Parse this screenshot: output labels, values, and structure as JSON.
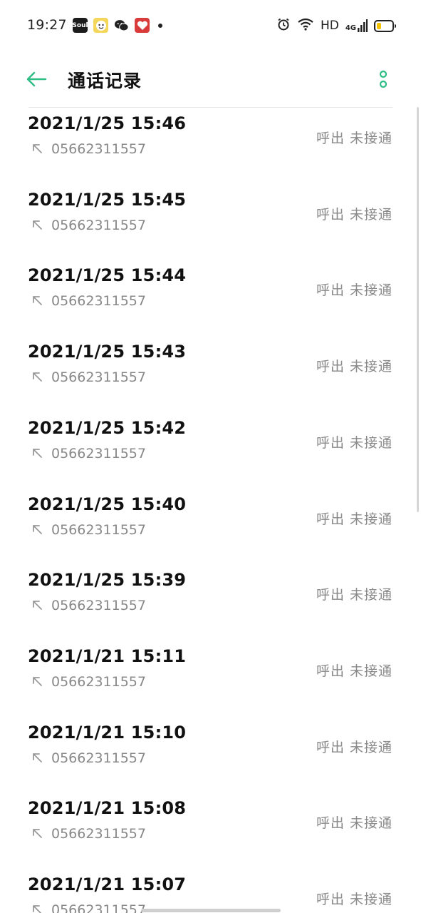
{
  "status_bar": {
    "time": "19:27",
    "network": "HD",
    "signal_label": "4G",
    "app_icons": [
      "soul-app-icon",
      "cartoon-app-icon",
      "wechat-icon",
      "heart-app-icon"
    ]
  },
  "header": {
    "title": "通话记录"
  },
  "colors": {
    "accent": "#2ebd85",
    "date_text": "#111111",
    "secondary_text": "#888888"
  },
  "calls": [
    {
      "datetime": "2021/1/25 15:46",
      "number": "05662311557",
      "status": "呼出 未接通"
    },
    {
      "datetime": "2021/1/25 15:45",
      "number": "05662311557",
      "status": "呼出 未接通"
    },
    {
      "datetime": "2021/1/25 15:44",
      "number": "05662311557",
      "status": "呼出 未接通"
    },
    {
      "datetime": "2021/1/25 15:43",
      "number": "05662311557",
      "status": "呼出 未接通"
    },
    {
      "datetime": "2021/1/25 15:42",
      "number": "05662311557",
      "status": "呼出 未接通"
    },
    {
      "datetime": "2021/1/25 15:40",
      "number": "05662311557",
      "status": "呼出 未接通"
    },
    {
      "datetime": "2021/1/25 15:39",
      "number": "05662311557",
      "status": "呼出 未接通"
    },
    {
      "datetime": "2021/1/21 15:11",
      "number": "05662311557",
      "status": "呼出 未接通"
    },
    {
      "datetime": "2021/1/21 15:10",
      "number": "05662311557",
      "status": "呼出 未接通"
    },
    {
      "datetime": "2021/1/21 15:08",
      "number": "05662311557",
      "status": "呼出 未接通"
    },
    {
      "datetime": "2021/1/21 15:07",
      "number": "05662311557",
      "status": "呼出 未接通"
    }
  ]
}
